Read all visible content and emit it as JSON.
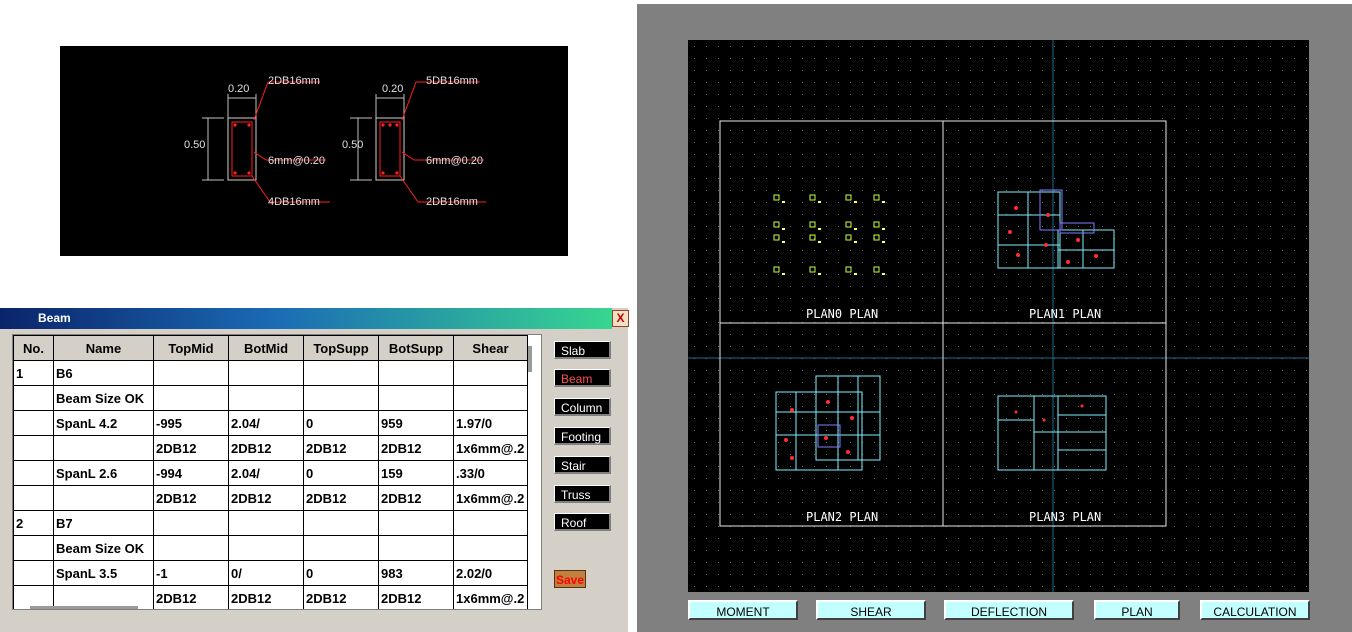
{
  "section_preview": {
    "left_section": {
      "width_label": "0.20",
      "height_label": "0.50",
      "top_bars": "2DB16mm",
      "stirrup": "6mm@0.20",
      "bottom_bars": "4DB16mm"
    },
    "right_section": {
      "width_label": "0.20",
      "height_label": "0.50",
      "top_bars": "5DB16mm",
      "stirrup": "6mm@0.20",
      "bottom_bars": "2DB16mm"
    }
  },
  "beam_dialog": {
    "title": "Beam",
    "close_glyph": "X",
    "columns": [
      "No.",
      "Name",
      "TopMid",
      "BotMid",
      "TopSupp",
      "BotSupp",
      "Shear"
    ],
    "rows": [
      [
        "1",
        "B6",
        "",
        "",
        "",
        "",
        ""
      ],
      [
        "",
        "Beam Size OK",
        "",
        "",
        "",
        "",
        ""
      ],
      [
        "",
        "SpanL 4.2",
        "-995",
        "2.04/",
        "0",
        "959",
        "1.97/0"
      ],
      [
        "",
        "",
        "2DB12",
        "2DB12",
        "2DB12",
        "2DB12",
        "1x6mm@.2"
      ],
      [
        "",
        "SpanL 2.6",
        "-994",
        "2.04/",
        "0",
        "159",
        ".33/0"
      ],
      [
        "",
        "",
        "2DB12",
        "2DB12",
        "2DB12",
        "2DB12",
        "1x6mm@.2"
      ],
      [
        "2",
        "B7",
        "",
        "",
        "",
        "",
        ""
      ],
      [
        "",
        "Beam Size OK",
        "",
        "",
        "",
        "",
        ""
      ],
      [
        "",
        "SpanL 3.5",
        "-1",
        "0/",
        "0",
        "983",
        "2.02/0"
      ],
      [
        "",
        "",
        "2DB12",
        "2DB12",
        "2DB12",
        "2DB12",
        "1x6mm@.2"
      ]
    ],
    "side_buttons": [
      "Slab",
      "Beam",
      "Column",
      "Footing",
      "Stair",
      "Truss",
      "Roof"
    ],
    "active_button": "Beam",
    "save_label": "Save"
  },
  "cad": {
    "plan_labels": [
      "PLAN0 PLAN",
      "PLAN1 PLAN",
      "PLAN2 PLAN",
      "PLAN3 PLAN"
    ]
  },
  "bottom_buttons": [
    "MOMENT",
    "SHEAR",
    "DEFLECTION",
    "PLAN",
    "CALCULATION"
  ],
  "colors": {
    "cad_background": "#000000",
    "plan_lines": "#7ff0ff",
    "dimension_red": "#ff2020",
    "active_tab_text": "#ff5050",
    "bottom_button_bg": "#c4ffff"
  }
}
